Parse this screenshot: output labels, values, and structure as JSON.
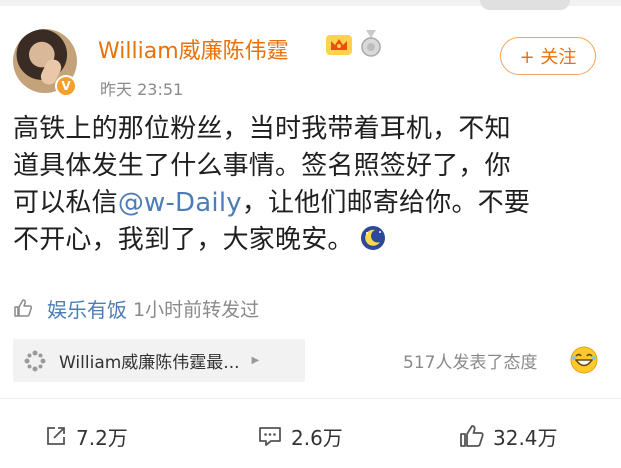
{
  "post": {
    "author": {
      "name": "William威廉陈伟霆",
      "verified_badge": "V",
      "badge_color": "#f3a12b",
      "name_color": "#e8710a"
    },
    "meta": {
      "time": "昨天 23:51"
    },
    "follow_label": "+ 关注",
    "content": {
      "line1": "高铁上的那位粉丝，当时我带着耳机，不知",
      "line2": "道具体发生了什么事情。签名照签好了，你",
      "line3_before": "可以私信",
      "mention": "@w-Daily",
      "line3_after": "，让他们邮寄给你。不要",
      "line4": "不开心，我到了，大家晚安。"
    },
    "liked_by": {
      "source": "娱乐有饭",
      "meta": "1小时前转发过",
      "link_color": "#4d7db6"
    },
    "card": {
      "title": "William威廉陈伟霆最...",
      "icon": "pinwheel-icon"
    },
    "reactions": {
      "text": "517人发表了态度",
      "icon": "laugh-emoji-icon"
    },
    "actions": {
      "repost": "7.2万",
      "comment": "2.6万",
      "like": "32.4万"
    }
  }
}
